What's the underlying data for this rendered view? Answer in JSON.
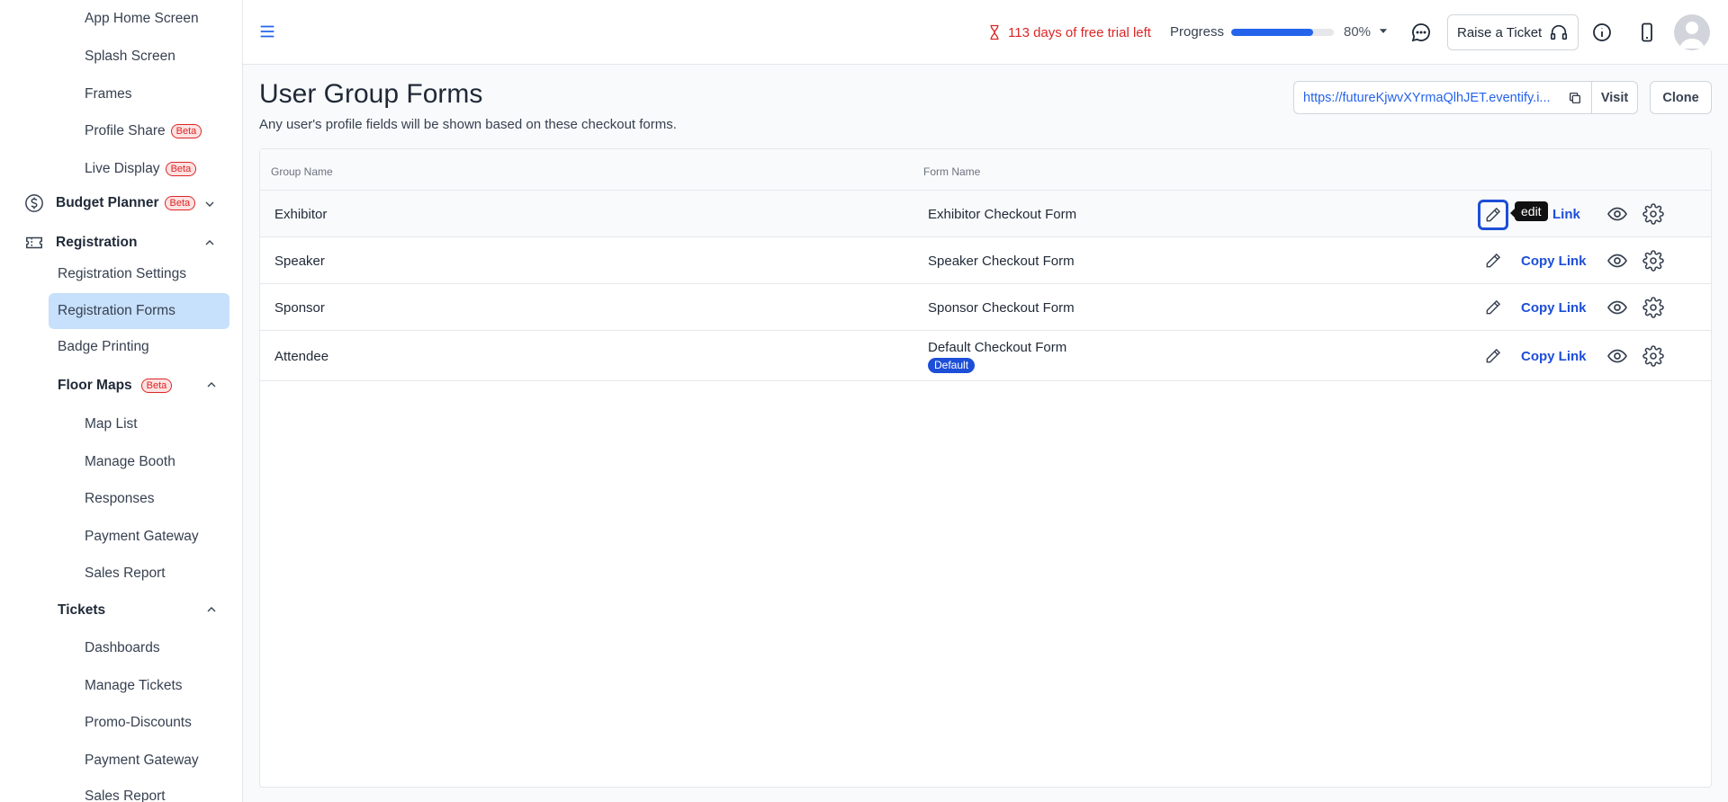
{
  "sidebar": {
    "items": [
      {
        "label": "App Home Screen"
      },
      {
        "label": "Splash Screen"
      },
      {
        "label": "Frames"
      },
      {
        "label": "Profile Share",
        "badge": "Beta"
      },
      {
        "label": "Live Display",
        "badge": "Beta"
      }
    ],
    "budget_planner": {
      "label": "Budget Planner",
      "badge": "Beta"
    },
    "registration": {
      "label": "Registration",
      "items": [
        {
          "label": "Registration Settings"
        },
        {
          "label": "Registration Forms"
        },
        {
          "label": "Badge Printing"
        }
      ]
    },
    "floor_maps": {
      "label": "Floor Maps",
      "badge": "Beta",
      "items": [
        {
          "label": "Map List"
        },
        {
          "label": "Manage Booth"
        },
        {
          "label": "Responses"
        },
        {
          "label": "Payment Gateway"
        },
        {
          "label": "Sales Report"
        }
      ]
    },
    "tickets": {
      "label": "Tickets",
      "items": [
        {
          "label": "Dashboards"
        },
        {
          "label": "Manage Tickets"
        },
        {
          "label": "Promo-Discounts"
        },
        {
          "label": "Payment Gateway"
        },
        {
          "label": "Sales Report"
        }
      ]
    }
  },
  "header": {
    "trial_text": "113 days of free trial left",
    "progress_label": "Progress",
    "progress_value": 0.8,
    "progress_text": "80%",
    "raise_ticket_label": "Raise a Ticket"
  },
  "main": {
    "title": "User Group Forms",
    "subtitle": "Any user's profile fields will be shown based on these checkout forms.",
    "url": "https://futureKjwvXYrmaQlhJET.eventify.i...",
    "visit_label": "Visit",
    "clone_label": "Clone",
    "columns": {
      "group": "Group Name",
      "form": "Form Name"
    },
    "rows": [
      {
        "group": "Exhibitor",
        "form": "Exhibitor Checkout Form",
        "link_label": "Link"
      },
      {
        "group": "Speaker",
        "form": "Speaker Checkout Form",
        "link_label": "Copy Link"
      },
      {
        "group": "Sponsor",
        "form": "Sponsor Checkout Form",
        "link_label": "Copy Link"
      },
      {
        "group": "Attendee",
        "form": "Default Checkout Form",
        "badge": "Default",
        "link_label": "Copy Link"
      }
    ],
    "tooltip": "edit"
  },
  "colors": {
    "accent": "#2563eb",
    "danger": "#dc2626",
    "active_bg": "#c7e0fb"
  }
}
